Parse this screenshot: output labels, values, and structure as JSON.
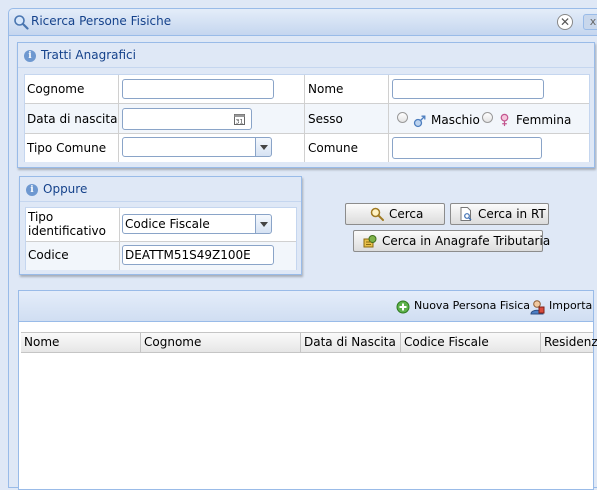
{
  "window": {
    "title": "Ricerca Persone Fisiche",
    "close_label": "✕",
    "close2_label": "x"
  },
  "tratti": {
    "title": "Tratti Anagrafici",
    "cognome_label": "Cognome",
    "cognome_value": "",
    "nome_label": "Nome",
    "nome_value": "",
    "data_nascita_label": "Data di nascita",
    "data_nascita_value": "",
    "sesso_label": "Sesso",
    "maschio_label": "Maschio",
    "femmina_label": "Femmina",
    "tipo_comune_label": "Tipo Comune",
    "tipo_comune_value": "",
    "comune_label": "Comune",
    "comune_value": ""
  },
  "oppure": {
    "title": "Oppure",
    "tipo_identificativo_label": "Tipo identificativo",
    "tipo_identificativo_value": "Codice Fiscale",
    "codice_label": "Codice",
    "codice_value": "DEATTM51S49Z100E"
  },
  "actions": {
    "cerca": "Cerca",
    "cerca_rt": "Cerca in RT",
    "cerca_anagrafe": "Cerca in Anagrafe Tributaria"
  },
  "results": {
    "nuova_persona": "Nuova Persona Fisica",
    "importa": "Importa",
    "columns": [
      "Nome",
      "Cognome",
      "Data di Nascita",
      "Codice Fiscale",
      "Residenz"
    ]
  },
  "icons": {
    "title": "search-icon",
    "info": "info-icon",
    "calendar": "calendar-icon",
    "male": "male-icon",
    "female": "female-icon",
    "add": "add-icon",
    "import": "import-user-icon",
    "cerca": "magnifier-icon",
    "cerca_rt": "document-icon",
    "anagrafe": "tax-registry-icon"
  },
  "colors": {
    "panel_bg": "#dfe8f6",
    "border": "#99bbe8",
    "title_text": "#15428b"
  }
}
